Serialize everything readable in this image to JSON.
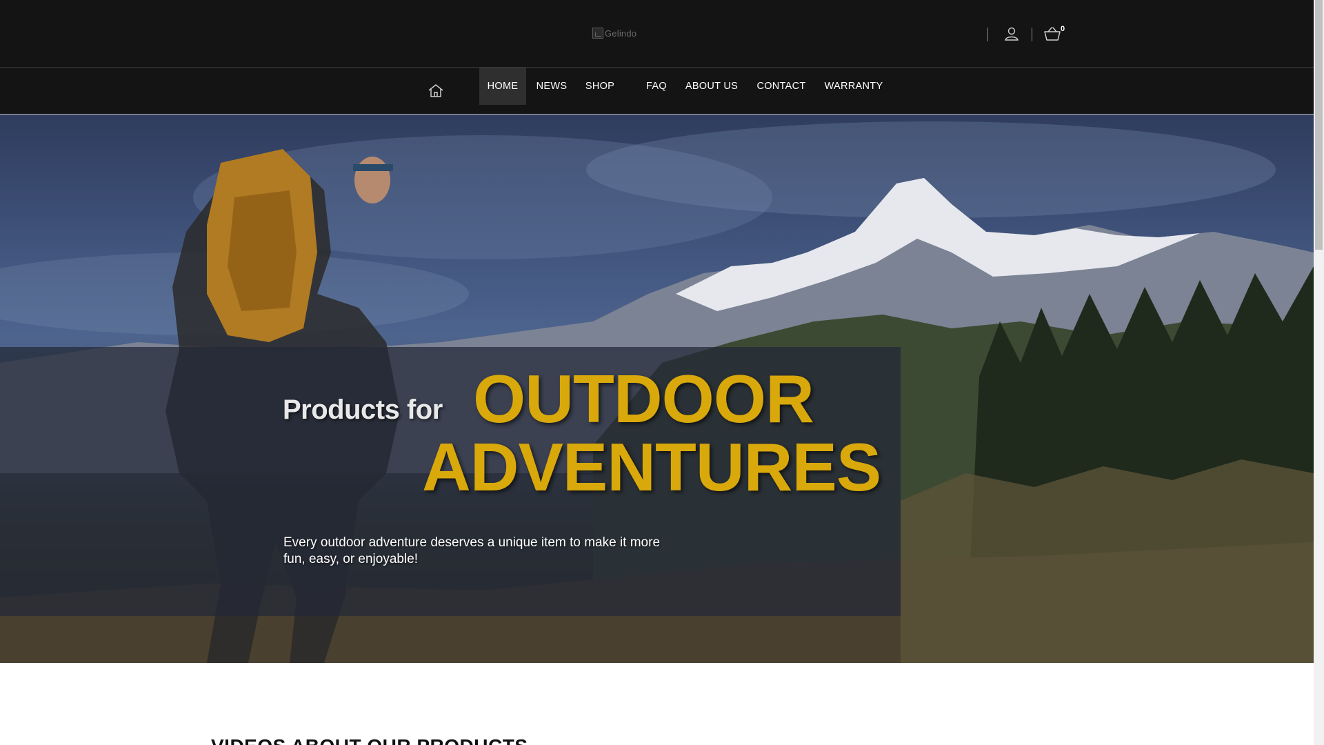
{
  "header": {
    "logo_alt": "Gelindo",
    "icons": {
      "user": "user-icon",
      "cart": "cart-icon"
    },
    "cart_count": "0"
  },
  "nav": {
    "home_icon": "home-icon",
    "items": [
      {
        "label": "HOME",
        "active": true
      },
      {
        "label": "NEWS"
      },
      {
        "label": "SHOP"
      },
      {
        "label": "FAQ"
      },
      {
        "label": "ABOUT US"
      },
      {
        "label": "CONTACT"
      },
      {
        "label": "WARRANTY"
      }
    ]
  },
  "hero": {
    "kicker": "Products for",
    "headline_line1": "OUTDOOR",
    "headline_line2": "ADVENTURES",
    "subtitle": "Every outdoor adventure deserves a unique item to make it more fun, easy, or enjoyable!"
  },
  "section": {
    "heading": "VIDEOS ABOUT OUR PRODUCTS"
  },
  "colors": {
    "header_bg": "#141414",
    "accent_yellow": "#d9a80b",
    "active_nav_bg": "#2f2f2f"
  }
}
